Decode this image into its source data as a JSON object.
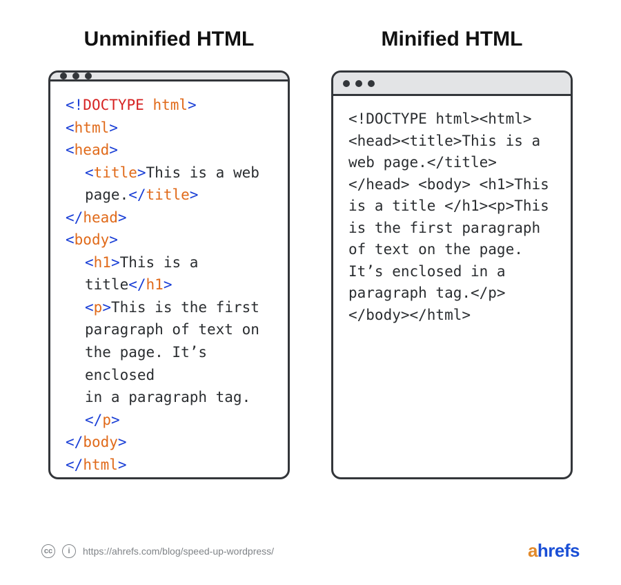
{
  "headings": {
    "left": "Unminified HTML",
    "right": "Minified HTML"
  },
  "unminified": {
    "doctype_open": "<!",
    "doctype_kw": "DOCTYPE",
    "doctype_sp": " ",
    "doctype_el": "html",
    "gt": ">",
    "lt": "<",
    "slash": "/",
    "tags": {
      "html": "html",
      "head": "head",
      "title": "title",
      "body": "body",
      "h1": "h1",
      "p": "p"
    },
    "text": {
      "title_a": "This is a web",
      "title_b": "page.",
      "h1": "This is a title",
      "para_a": "This is the first",
      "para_b": "paragraph of text on",
      "para_c": "the page. It’s enclosed",
      "para_d": "in a paragraph tag."
    }
  },
  "minified": {
    "content": "<!DOCTYPE html><html> <head><title>This is a web page.</title></head> <body> <h1>This is a title </h1><p>This is the first paragraph of text on the page. It’s enclosed in a paragraph tag.</p> </body></html>"
  },
  "footer": {
    "cc1": "cc",
    "cc2": "i",
    "url": "https://ahrefs.com/blog/speed-up-wordpress/",
    "brand_a": "a",
    "brand_rest": "hrefs"
  }
}
